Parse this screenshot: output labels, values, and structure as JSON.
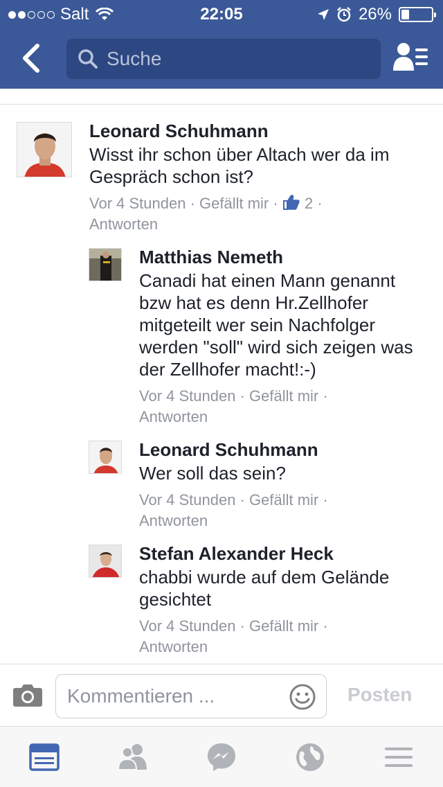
{
  "status_bar": {
    "carrier": "Salt",
    "time": "22:05",
    "battery": "26%",
    "battery_level": 0.26
  },
  "search": {
    "placeholder": "Suche"
  },
  "comments": [
    {
      "author": "Leonard Schuhmann",
      "text": "Wisst ihr schon über Altach wer da im Gespräch schon ist?",
      "time": "Vor 4 Stunden",
      "like_label": "Gefällt mir",
      "likes": "2",
      "reply_label": "Antworten"
    },
    {
      "author": "Matthias Nemeth",
      "text": "Canadi hat einen Mann genannt bzw hat es denn Hr.Zellhofer mitgeteilt wer sein Nachfolger werden \"soll\" wird sich zeigen was der Zellhofer macht!:-)",
      "time": "Vor 4 Stunden",
      "like_label": "Gefällt mir",
      "reply_label": "Antworten"
    },
    {
      "author": "Leonard Schuhmann",
      "text": "Wer soll das sein?",
      "time": "Vor 4 Stunden",
      "like_label": "Gefällt mir",
      "reply_label": "Antworten"
    },
    {
      "author": "Stefan Alexander Heck",
      "text": "chabbi wurde auf dem Gelände gesichtet",
      "time": "Vor 4 Stunden",
      "like_label": "Gefällt mir",
      "reply_label": "Antworten"
    }
  ],
  "composer": {
    "placeholder": "Kommentieren ...",
    "post_label": "Posten"
  },
  "tabs": [
    {
      "icon": "news-feed-icon",
      "active": true
    },
    {
      "icon": "friends-icon",
      "active": false
    },
    {
      "icon": "messenger-icon",
      "active": false
    },
    {
      "icon": "globe-icon",
      "active": false
    },
    {
      "icon": "menu-icon",
      "active": false
    }
  ],
  "colors": {
    "brand": "#3b5998",
    "meta_text": "#90949c",
    "like_blue": "#4267b2"
  }
}
